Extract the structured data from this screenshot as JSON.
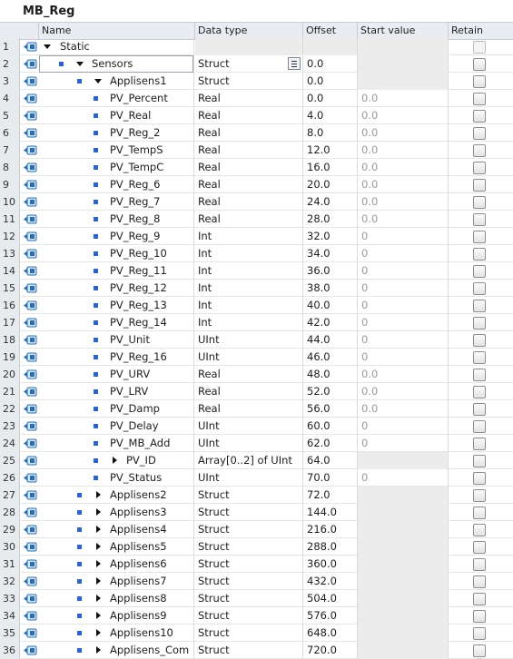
{
  "window": {
    "title": "MB_Reg"
  },
  "columns": {
    "name": "Name",
    "data_type": "Data type",
    "offset": "Offset",
    "start_value": "Start value",
    "retain": "Retain"
  },
  "rows": [
    {
      "num": "1",
      "name": "Static",
      "type": "",
      "offset": "",
      "start": "",
      "level": 0,
      "expander": "down",
      "dot": false
    },
    {
      "num": "2",
      "name": "Sensors",
      "type": "Struct",
      "offset": "0.0",
      "start": "",
      "level": 1,
      "expander": "down",
      "dot": true,
      "selected": true
    },
    {
      "num": "3",
      "name": "Applisens1",
      "type": "Struct",
      "offset": "0.0",
      "start": "",
      "level": 2,
      "expander": "down",
      "dot": true
    },
    {
      "num": "4",
      "name": "PV_Percent",
      "type": "Real",
      "offset": "0.0",
      "start": "0.0",
      "level": 3,
      "expander": "",
      "dot": true
    },
    {
      "num": "5",
      "name": "PV_Real",
      "type": "Real",
      "offset": "4.0",
      "start": "0.0",
      "level": 3,
      "expander": "",
      "dot": true
    },
    {
      "num": "6",
      "name": "PV_Reg_2",
      "type": "Real",
      "offset": "8.0",
      "start": "0.0",
      "level": 3,
      "expander": "",
      "dot": true
    },
    {
      "num": "7",
      "name": "PV_TempS",
      "type": "Real",
      "offset": "12.0",
      "start": "0.0",
      "level": 3,
      "expander": "",
      "dot": true
    },
    {
      "num": "8",
      "name": "PV_TempC",
      "type": "Real",
      "offset": "16.0",
      "start": "0.0",
      "level": 3,
      "expander": "",
      "dot": true
    },
    {
      "num": "9",
      "name": "PV_Reg_6",
      "type": "Real",
      "offset": "20.0",
      "start": "0.0",
      "level": 3,
      "expander": "",
      "dot": true
    },
    {
      "num": "10",
      "name": "PV_Reg_7",
      "type": "Real",
      "offset": "24.0",
      "start": "0.0",
      "level": 3,
      "expander": "",
      "dot": true
    },
    {
      "num": "11",
      "name": "PV_Reg_8",
      "type": "Real",
      "offset": "28.0",
      "start": "0.0",
      "level": 3,
      "expander": "",
      "dot": true
    },
    {
      "num": "12",
      "name": "PV_Reg_9",
      "type": "Int",
      "offset": "32.0",
      "start": "0",
      "level": 3,
      "expander": "",
      "dot": true
    },
    {
      "num": "13",
      "name": "PV_Reg_10",
      "type": "Int",
      "offset": "34.0",
      "start": "0",
      "level": 3,
      "expander": "",
      "dot": true
    },
    {
      "num": "14",
      "name": "PV_Reg_11",
      "type": "Int",
      "offset": "36.0",
      "start": "0",
      "level": 3,
      "expander": "",
      "dot": true
    },
    {
      "num": "15",
      "name": "PV_Reg_12",
      "type": "Int",
      "offset": "38.0",
      "start": "0",
      "level": 3,
      "expander": "",
      "dot": true
    },
    {
      "num": "16",
      "name": "PV_Reg_13",
      "type": "Int",
      "offset": "40.0",
      "start": "0",
      "level": 3,
      "expander": "",
      "dot": true
    },
    {
      "num": "17",
      "name": "PV_Reg_14",
      "type": "Int",
      "offset": "42.0",
      "start": "0",
      "level": 3,
      "expander": "",
      "dot": true
    },
    {
      "num": "18",
      "name": "PV_Unit",
      "type": "UInt",
      "offset": "44.0",
      "start": "0",
      "level": 3,
      "expander": "",
      "dot": true
    },
    {
      "num": "19",
      "name": "PV_Reg_16",
      "type": "UInt",
      "offset": "46.0",
      "start": "0",
      "level": 3,
      "expander": "",
      "dot": true
    },
    {
      "num": "20",
      "name": "PV_URV",
      "type": "Real",
      "offset": "48.0",
      "start": "0.0",
      "level": 3,
      "expander": "",
      "dot": true
    },
    {
      "num": "21",
      "name": "PV_LRV",
      "type": "Real",
      "offset": "52.0",
      "start": "0.0",
      "level": 3,
      "expander": "",
      "dot": true
    },
    {
      "num": "22",
      "name": "PV_Damp",
      "type": "Real",
      "offset": "56.0",
      "start": "0.0",
      "level": 3,
      "expander": "",
      "dot": true
    },
    {
      "num": "23",
      "name": "PV_Delay",
      "type": "UInt",
      "offset": "60.0",
      "start": "0",
      "level": 3,
      "expander": "",
      "dot": true
    },
    {
      "num": "24",
      "name": "PV_MB_Add",
      "type": "UInt",
      "offset": "62.0",
      "start": "0",
      "level": 3,
      "expander": "",
      "dot": true
    },
    {
      "num": "25",
      "name": "PV_ID",
      "type": "Array[0..2] of UInt",
      "offset": "64.0",
      "start": "",
      "level": 3,
      "expander": "right",
      "dot": true
    },
    {
      "num": "26",
      "name": "PV_Status",
      "type": "UInt",
      "offset": "70.0",
      "start": "0",
      "level": 3,
      "expander": "",
      "dot": true
    },
    {
      "num": "27",
      "name": "Applisens2",
      "type": "Struct",
      "offset": "72.0",
      "start": "",
      "level": 2,
      "expander": "right",
      "dot": true
    },
    {
      "num": "28",
      "name": "Applisens3",
      "type": "Struct",
      "offset": "144.0",
      "start": "",
      "level": 2,
      "expander": "right",
      "dot": true
    },
    {
      "num": "29",
      "name": "Applisens4",
      "type": "Struct",
      "offset": "216.0",
      "start": "",
      "level": 2,
      "expander": "right",
      "dot": true
    },
    {
      "num": "30",
      "name": "Applisens5",
      "type": "Struct",
      "offset": "288.0",
      "start": "",
      "level": 2,
      "expander": "right",
      "dot": true
    },
    {
      "num": "31",
      "name": "Applisens6",
      "type": "Struct",
      "offset": "360.0",
      "start": "",
      "level": 2,
      "expander": "right",
      "dot": true
    },
    {
      "num": "32",
      "name": "Applisens7",
      "type": "Struct",
      "offset": "432.0",
      "start": "",
      "level": 2,
      "expander": "right",
      "dot": true
    },
    {
      "num": "33",
      "name": "Applisens8",
      "type": "Struct",
      "offset": "504.0",
      "start": "",
      "level": 2,
      "expander": "right",
      "dot": true
    },
    {
      "num": "34",
      "name": "Applisens9",
      "type": "Struct",
      "offset": "576.0",
      "start": "",
      "level": 2,
      "expander": "right",
      "dot": true
    },
    {
      "num": "35",
      "name": "Applisens10",
      "type": "Struct",
      "offset": "648.0",
      "start": "",
      "level": 2,
      "expander": "right",
      "dot": true
    },
    {
      "num": "36",
      "name": "Applisens_Com",
      "type": "Struct",
      "offset": "720.0",
      "start": "",
      "level": 2,
      "expander": "right",
      "dot": true
    }
  ],
  "colors": {
    "dot": "#2f62c8",
    "header_bg": "#e9edf2",
    "shade": "#ececec"
  },
  "icons": {
    "row_type": "tag-io-icon",
    "expander": "triangle-icon",
    "browse": "list-browse-icon"
  }
}
